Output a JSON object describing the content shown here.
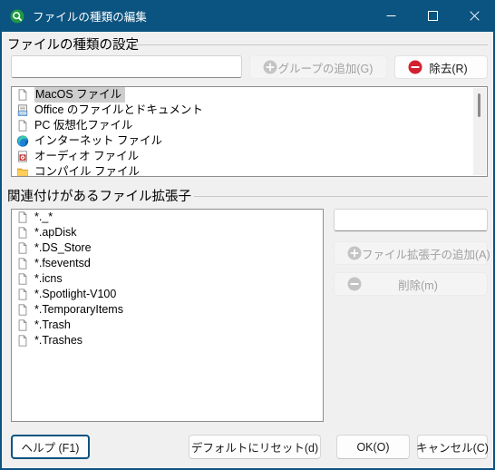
{
  "window": {
    "title": "ファイルの種類の編集",
    "icon": "search-green-icon",
    "accent_color": "#0b5380",
    "controls": {
      "minimize": "最小化",
      "maximize": "最大化",
      "close": "閉じる"
    }
  },
  "file_type_group": {
    "label": "ファイルの種類の設定",
    "name_input": {
      "value": "",
      "placeholder": ""
    },
    "add_group_button": {
      "label": "グループの追加(G)",
      "accelerator": "G",
      "icon": "plus-circle-icon",
      "enabled": false
    },
    "remove_button": {
      "label": "除去(R)",
      "accelerator": "R",
      "icon": "minus-circle-icon",
      "icon_color": "#d32030",
      "enabled": true
    },
    "list": {
      "selected_index": 0,
      "items": [
        {
          "label": "MacOS ファイル",
          "icon": "blank-page-icon"
        },
        {
          "label": "Office のファイルとドキュメント",
          "icon": "doc-file-icon"
        },
        {
          "label": "PC 仮想化ファイル",
          "icon": "blank-page-icon"
        },
        {
          "label": "インターネット ファイル",
          "icon": "edge-browser-icon"
        },
        {
          "label": "オーディオ ファイル",
          "icon": "audio-file-icon"
        },
        {
          "label": "コンパイル ファイル",
          "icon": "folder-icon"
        }
      ]
    }
  },
  "extensions_group": {
    "label": "関連付けがあるファイル拡張子",
    "extension_input": {
      "value": "",
      "placeholder": ""
    },
    "add_extension_button": {
      "label": "ファイル拡張子の追加(A)",
      "accelerator": "A",
      "icon": "plus-circle-icon",
      "enabled": false
    },
    "delete_button": {
      "label": "削除(m)",
      "accelerator": "m",
      "icon": "minus-circle-icon",
      "enabled": false
    },
    "list": {
      "items": [
        {
          "label": "*._*",
          "icon": "blank-page-icon"
        },
        {
          "label": "*.apDisk",
          "icon": "blank-page-icon"
        },
        {
          "label": "*.DS_Store",
          "icon": "blank-page-icon"
        },
        {
          "label": "*.fseventsd",
          "icon": "blank-page-icon"
        },
        {
          "label": "*.icns",
          "icon": "blank-page-icon"
        },
        {
          "label": "*.Spotlight-V100",
          "icon": "blank-page-icon"
        },
        {
          "label": "*.TemporaryItems",
          "icon": "blank-page-icon"
        },
        {
          "label": "*.Trash",
          "icon": "blank-page-icon"
        },
        {
          "label": "*.Trashes",
          "icon": "blank-page-icon"
        }
      ]
    }
  },
  "footer": {
    "help_button": {
      "label": "ヘルプ (F1)",
      "focused": true
    },
    "reset_button": {
      "label": "デフォルトにリセット(d)",
      "accelerator": "d"
    },
    "ok_button": {
      "label": "OK(O)",
      "accelerator": "O"
    },
    "cancel_button": {
      "label": "キャンセル(C)",
      "accelerator": "C"
    }
  }
}
